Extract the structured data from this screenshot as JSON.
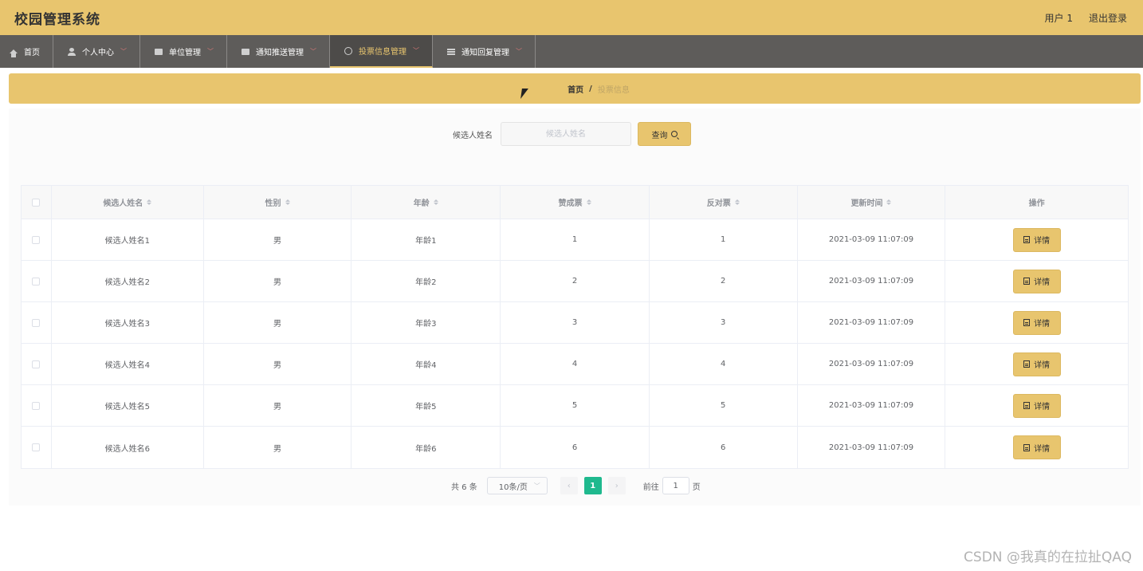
{
  "header": {
    "app_title": "校园管理系统",
    "user_label": "用户 1",
    "logout_label": "退出登录"
  },
  "nav": {
    "items": [
      {
        "label": "首页",
        "icon": "home-icon"
      },
      {
        "label": "个人中心",
        "icon": "user-icon"
      },
      {
        "label": "单位管理",
        "icon": "box-icon"
      },
      {
        "label": "通知推送管理",
        "icon": "monitor-icon"
      },
      {
        "label": "投票信息管理",
        "icon": "target-icon",
        "active": true
      },
      {
        "label": "通知回复管理",
        "icon": "list-icon"
      }
    ]
  },
  "breadcrumb": {
    "home": "首页",
    "separator": "/",
    "current": "投票信息"
  },
  "search": {
    "label": "候选人姓名",
    "placeholder": "候选人姓名",
    "value": "",
    "button_label": "查询"
  },
  "table": {
    "headers": [
      "候选人姓名",
      "性别",
      "年龄",
      "赞成票",
      "反对票",
      "更新时间",
      "操作"
    ],
    "rows": [
      {
        "name": "候选人姓名1",
        "gender": "男",
        "age": "年龄1",
        "approve": "1",
        "oppose": "1",
        "updated": "2021-03-09 11:07:09",
        "action": "详情"
      },
      {
        "name": "候选人姓名2",
        "gender": "男",
        "age": "年龄2",
        "approve": "2",
        "oppose": "2",
        "updated": "2021-03-09 11:07:09",
        "action": "详情"
      },
      {
        "name": "候选人姓名3",
        "gender": "男",
        "age": "年龄3",
        "approve": "3",
        "oppose": "3",
        "updated": "2021-03-09 11:07:09",
        "action": "详情"
      },
      {
        "name": "候选人姓名4",
        "gender": "男",
        "age": "年龄4",
        "approve": "4",
        "oppose": "4",
        "updated": "2021-03-09 11:07:09",
        "action": "详情"
      },
      {
        "name": "候选人姓名5",
        "gender": "男",
        "age": "年龄5",
        "approve": "5",
        "oppose": "5",
        "updated": "2021-03-09 11:07:09",
        "action": "详情"
      },
      {
        "name": "候选人姓名6",
        "gender": "男",
        "age": "年龄6",
        "approve": "6",
        "oppose": "6",
        "updated": "2021-03-09 11:07:09",
        "action": "详情"
      }
    ]
  },
  "pagination": {
    "total": "共 6 条",
    "page_size": "10条/页",
    "current_page": "1",
    "goto_label": "前往",
    "goto_value": "1",
    "page_unit": "页",
    "prev": "‹",
    "next": "›"
  },
  "watermark": "CSDN @我真的在拉扯QAQ",
  "colors": {
    "accent": "#e8c56e",
    "nav_bg": "#5e5c5a",
    "page_active": "#1fb98e"
  }
}
